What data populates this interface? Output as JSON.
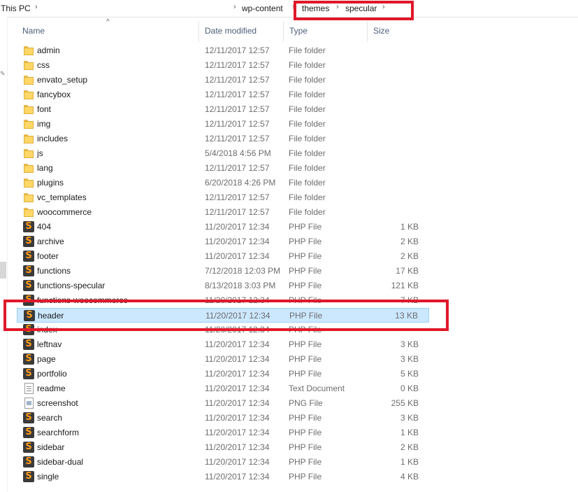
{
  "breadcrumb": {
    "root": "This PC",
    "items": [
      "wp-content",
      "themes",
      "specular"
    ]
  },
  "columns": {
    "name": "Name",
    "date": "Date modified",
    "type": "Type",
    "size": "Size"
  },
  "files": [
    {
      "name": "admin",
      "date": "12/11/2017 12:57",
      "type": "File folder",
      "size": "",
      "icon": "folder-icon"
    },
    {
      "name": "css",
      "date": "12/11/2017 12:57",
      "type": "File folder",
      "size": "",
      "icon": "folder-icon"
    },
    {
      "name": "envato_setup",
      "date": "12/11/2017 12:57",
      "type": "File folder",
      "size": "",
      "icon": "folder-icon"
    },
    {
      "name": "fancybox",
      "date": "12/11/2017 12:57",
      "type": "File folder",
      "size": "",
      "icon": "folder-icon"
    },
    {
      "name": "font",
      "date": "12/11/2017 12:57",
      "type": "File folder",
      "size": "",
      "icon": "folder-icon"
    },
    {
      "name": "img",
      "date": "12/11/2017 12:57",
      "type": "File folder",
      "size": "",
      "icon": "folder-icon"
    },
    {
      "name": "includes",
      "date": "12/11/2017 12:57",
      "type": "File folder",
      "size": "",
      "icon": "folder-icon"
    },
    {
      "name": "js",
      "date": "5/4/2018 4:56 PM",
      "type": "File folder",
      "size": "",
      "icon": "folder-icon"
    },
    {
      "name": "lang",
      "date": "12/11/2017 12:57",
      "type": "File folder",
      "size": "",
      "icon": "folder-icon"
    },
    {
      "name": "plugins",
      "date": "6/20/2018 4:26 PM",
      "type": "File folder",
      "size": "",
      "icon": "folder-icon"
    },
    {
      "name": "vc_templates",
      "date": "12/11/2017 12:57",
      "type": "File folder",
      "size": "",
      "icon": "folder-icon"
    },
    {
      "name": "woocommerce",
      "date": "12/11/2017 12:57",
      "type": "File folder",
      "size": "",
      "icon": "folder-icon"
    },
    {
      "name": "404",
      "date": "11/20/2017 12:34",
      "type": "PHP File",
      "size": "1 KB",
      "icon": "php-file-icon"
    },
    {
      "name": "archive",
      "date": "11/20/2017 12:34",
      "type": "PHP File",
      "size": "2 KB",
      "icon": "php-file-icon"
    },
    {
      "name": "footer",
      "date": "11/20/2017 12:34",
      "type": "PHP File",
      "size": "2 KB",
      "icon": "php-file-icon"
    },
    {
      "name": "functions",
      "date": "7/12/2018 12:03 PM",
      "type": "PHP File",
      "size": "17 KB",
      "icon": "php-file-icon"
    },
    {
      "name": "functions-specular",
      "date": "8/13/2018 3:03 PM",
      "type": "PHP File",
      "size": "121 KB",
      "icon": "php-file-icon"
    },
    {
      "name": "functions-woocommerce",
      "date": "11/20/2017 12:34",
      "type": "PHP File",
      "size": "7 KB",
      "icon": "php-file-icon"
    },
    {
      "name": "header",
      "date": "11/20/2017 12:34",
      "type": "PHP File",
      "size": "13 KB",
      "icon": "php-file-icon",
      "selected": true
    },
    {
      "name": "index",
      "date": "11/20/2017 12:34",
      "type": "PHP File",
      "size": "",
      "icon": "php-file-icon"
    },
    {
      "name": "leftnav",
      "date": "11/20/2017 12:34",
      "type": "PHP File",
      "size": "3 KB",
      "icon": "php-file-icon"
    },
    {
      "name": "page",
      "date": "11/20/2017 12:34",
      "type": "PHP File",
      "size": "3 KB",
      "icon": "php-file-icon"
    },
    {
      "name": "portfolio",
      "date": "11/20/2017 12:34",
      "type": "PHP File",
      "size": "5 KB",
      "icon": "php-file-icon"
    },
    {
      "name": "readme",
      "date": "11/20/2017 12:34",
      "type": "Text Document",
      "size": "0 KB",
      "icon": "text-file-icon"
    },
    {
      "name": "screenshot",
      "date": "11/20/2017 12:34",
      "type": "PNG File",
      "size": "255 KB",
      "icon": "png-file-icon"
    },
    {
      "name": "search",
      "date": "11/20/2017 12:34",
      "type": "PHP File",
      "size": "3 KB",
      "icon": "php-file-icon"
    },
    {
      "name": "searchform",
      "date": "11/20/2017 12:34",
      "type": "PHP File",
      "size": "1 KB",
      "icon": "php-file-icon"
    },
    {
      "name": "sidebar",
      "date": "11/20/2017 12:34",
      "type": "PHP File",
      "size": "2 KB",
      "icon": "php-file-icon"
    },
    {
      "name": "sidebar-dual",
      "date": "11/20/2017 12:34",
      "type": "PHP File",
      "size": "1 KB",
      "icon": "php-file-icon"
    },
    {
      "name": "single",
      "date": "11/20/2017 12:34",
      "type": "PHP File",
      "size": "4 KB",
      "icon": "php-file-icon"
    }
  ],
  "colors": {
    "selection_bg": "#cce8ff",
    "selection_border": "#99d1ff",
    "annotation_red": "#e0182a"
  }
}
